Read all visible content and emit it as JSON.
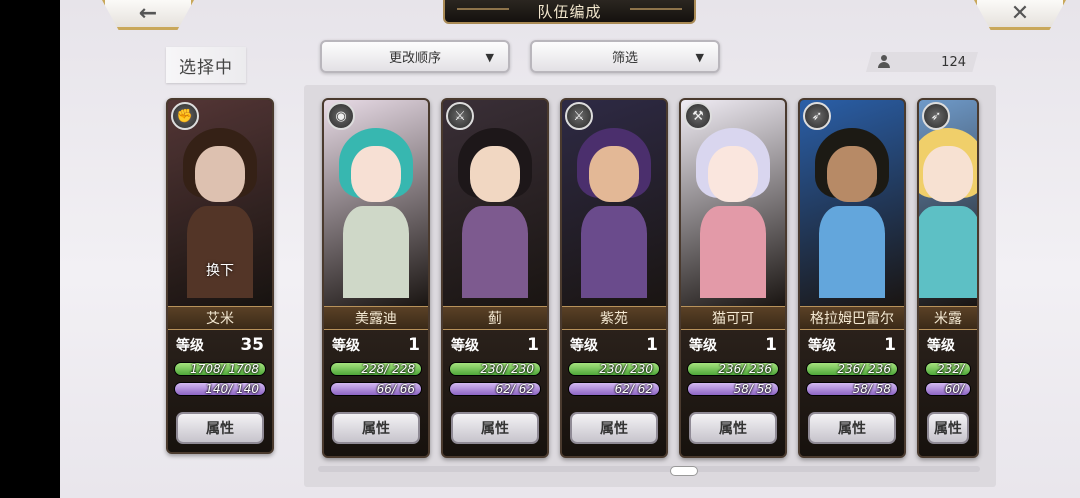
{
  "header": {
    "title": "队伍编成",
    "back_icon": "←",
    "close_icon": "✕"
  },
  "selecting_label": "选择中",
  "controls": {
    "order": {
      "label": "更改顺序",
      "arrow": "▼"
    },
    "filter": {
      "label": "筛选",
      "arrow": "▼"
    }
  },
  "roster_count": "124",
  "labels": {
    "level": "等级",
    "attributes": "属性",
    "swap": "换下"
  },
  "selected": {
    "name": "艾米",
    "level": "35",
    "hp": "1708/ 1708",
    "sp": "140/  140",
    "hp_frac": 1.0,
    "sp_frac": 1.0,
    "element_icon": "fist-icon",
    "element_glyph": "✊",
    "colors": {
      "bg": "#5b3b3b",
      "hair": "#3a2418",
      "skin": "#f0d2bf",
      "body": "#5b3a2b"
    }
  },
  "cards": [
    {
      "name": "美露迪",
      "level": "1",
      "hp": "228/  228",
      "sp": "66/  66",
      "hp_frac": 1.0,
      "sp_frac": 1.0,
      "element_icon": "swirl-icon",
      "element_glyph": "◉",
      "colors": {
        "bg": "#e8dbe6",
        "hair": "#37b7b0",
        "skin": "#f7e0d4",
        "body": "#cfd8c8"
      }
    },
    {
      "name": "蓟",
      "level": "1",
      "hp": "230/  230",
      "sp": "62/  62",
      "hp_frac": 1.0,
      "sp_frac": 1.0,
      "element_icon": "sword-icon",
      "element_glyph": "⚔",
      "colors": {
        "bg": "#3a2f37",
        "hair": "#1d1719",
        "skin": "#f1d7c2",
        "body": "#7d5a8f"
      }
    },
    {
      "name": "紫苑",
      "level": "1",
      "hp": "230/  230",
      "sp": "62/  62",
      "hp_frac": 1.0,
      "sp_frac": 1.0,
      "element_icon": "sword-icon",
      "element_glyph": "⚔",
      "colors": {
        "bg": "#2e2a45",
        "hair": "#4b2f6d",
        "skin": "#e3b896",
        "body": "#6a4b8c"
      }
    },
    {
      "name": "猫可可",
      "level": "1",
      "hp": "236/  236",
      "sp": "58/  58",
      "hp_frac": 1.0,
      "sp_frac": 1.0,
      "element_icon": "axe-icon",
      "element_glyph": "⚒",
      "colors": {
        "bg": "#f0ecf4",
        "hair": "#d9d6ef",
        "skin": "#fae6de",
        "body": "#e39aa8"
      }
    },
    {
      "name": "格拉姆巴雷尔",
      "level": "1",
      "hp": "236/  236",
      "sp": "58/  58",
      "hp_frac": 1.0,
      "sp_frac": 1.0,
      "element_icon": "spear-icon",
      "element_glyph": "➶",
      "colors": {
        "bg": "#2a5fa8",
        "hair": "#1c1a14",
        "skin": "#b78a66",
        "body": "#63a6dc"
      }
    },
    {
      "name": "米露",
      "level": "",
      "hp": "232/",
      "sp": "60/",
      "hp_frac": 1.0,
      "sp_frac": 1.0,
      "element_icon": "arrow-icon",
      "element_glyph": "➶",
      "colors": {
        "bg": "#6f9ac9",
        "hair": "#f0cf6a",
        "skin": "#f7e1d2",
        "body": "#5dc0c5"
      }
    }
  ]
}
